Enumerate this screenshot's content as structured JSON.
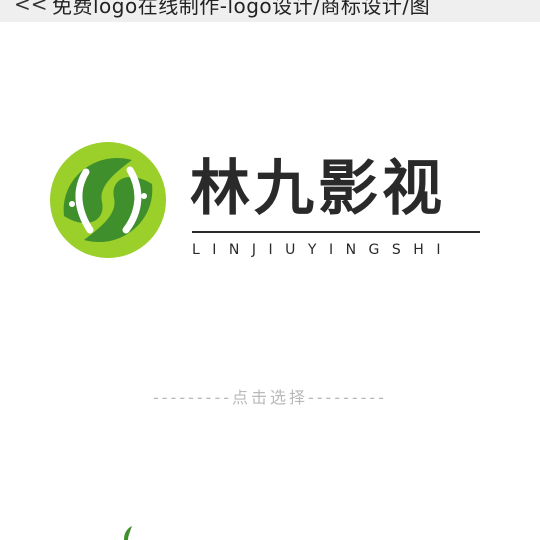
{
  "header": {
    "back_glyph": "<<",
    "title": "免费logo在线制作-logo设计/商标设计/图"
  },
  "logo": {
    "brand_name": "林九影视",
    "pinyin": "LINJIUYINGSHI",
    "colors": {
      "green_dark": "#3f8f2c",
      "green_light": "#9bcf2a",
      "text": "#2a2a2a"
    }
  },
  "hint": {
    "text": "---------点击选择---------"
  }
}
